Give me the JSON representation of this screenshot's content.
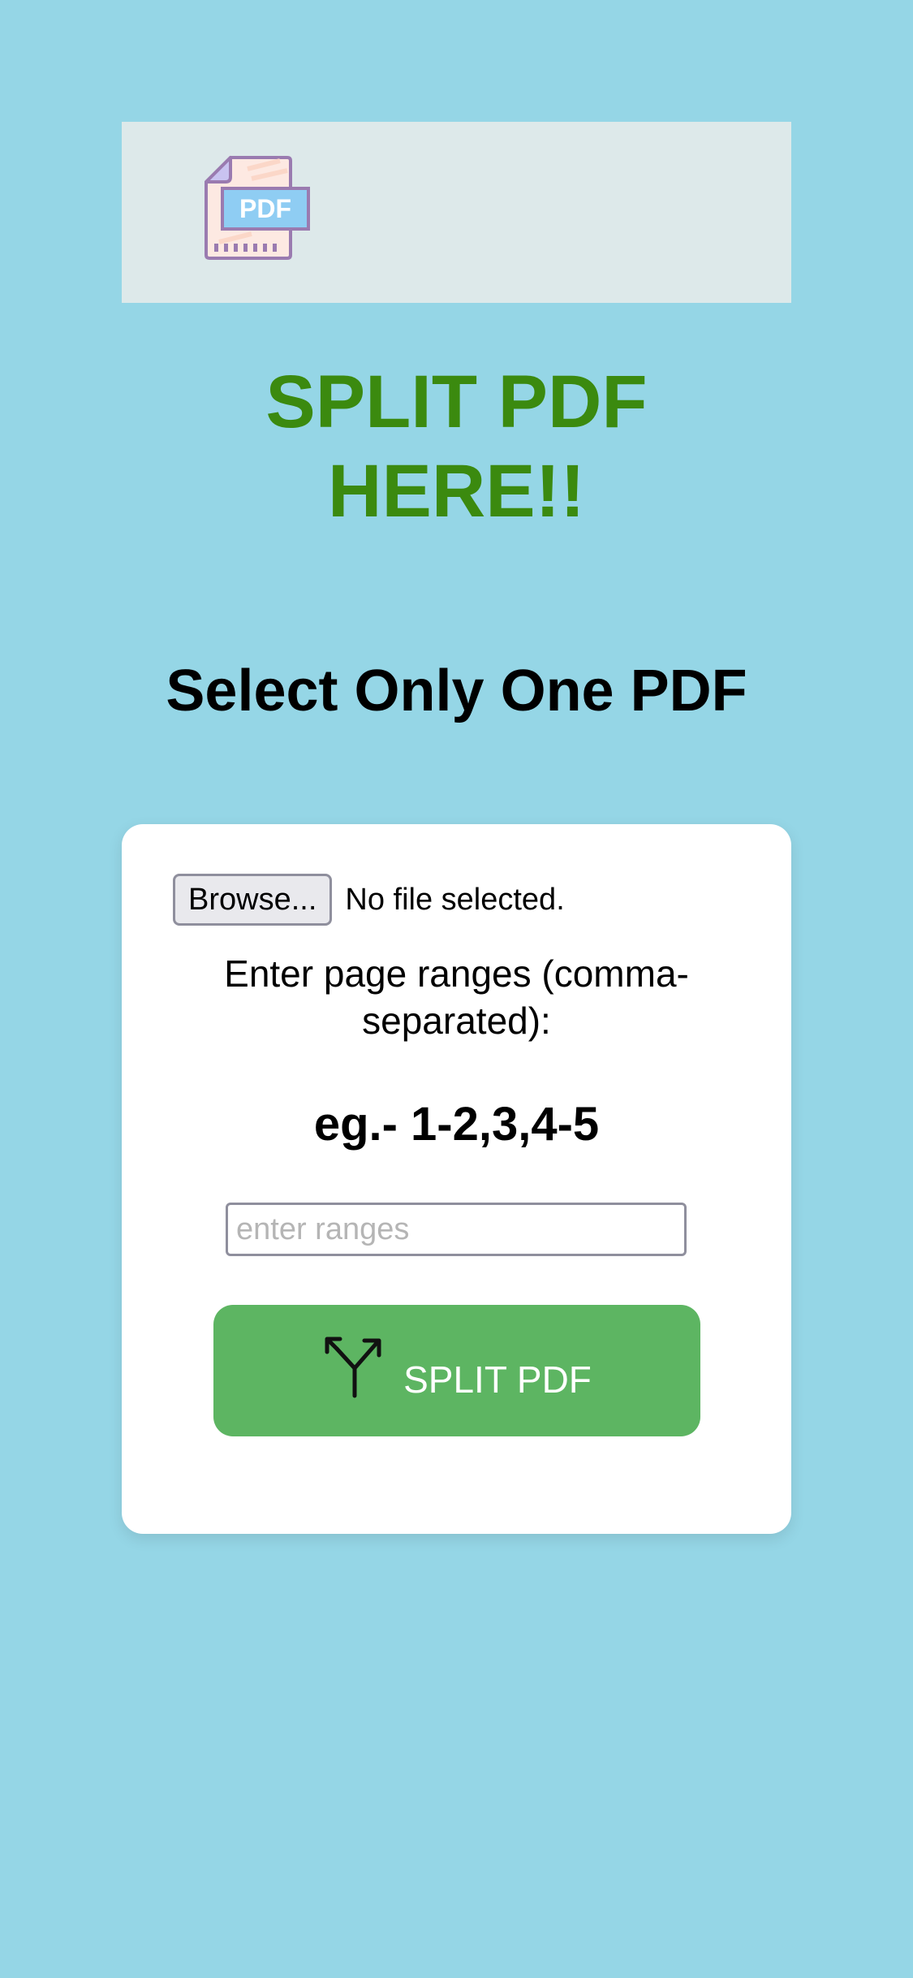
{
  "header": {
    "logo_icon": "pdf-file-icon",
    "logo_text": "PDF"
  },
  "title": {
    "line1": "SPLIT PDF",
    "line2": "HERE!!"
  },
  "subtitle": "Select Only One PDF",
  "form": {
    "browse_label": "Browse...",
    "file_status": "No file selected.",
    "range_label": "Enter page ranges (comma-separated):",
    "example": "eg.- 1-2,3,4-5",
    "range_input": {
      "value": "",
      "placeholder": "enter ranges"
    },
    "split_button": {
      "label": "SPLIT PDF",
      "icon": "split-arrows-icon"
    }
  },
  "colors": {
    "background": "#95d6e6",
    "header_bar": "#dde9ea",
    "title": "#3b8a0f",
    "split_button": "#5db562"
  }
}
